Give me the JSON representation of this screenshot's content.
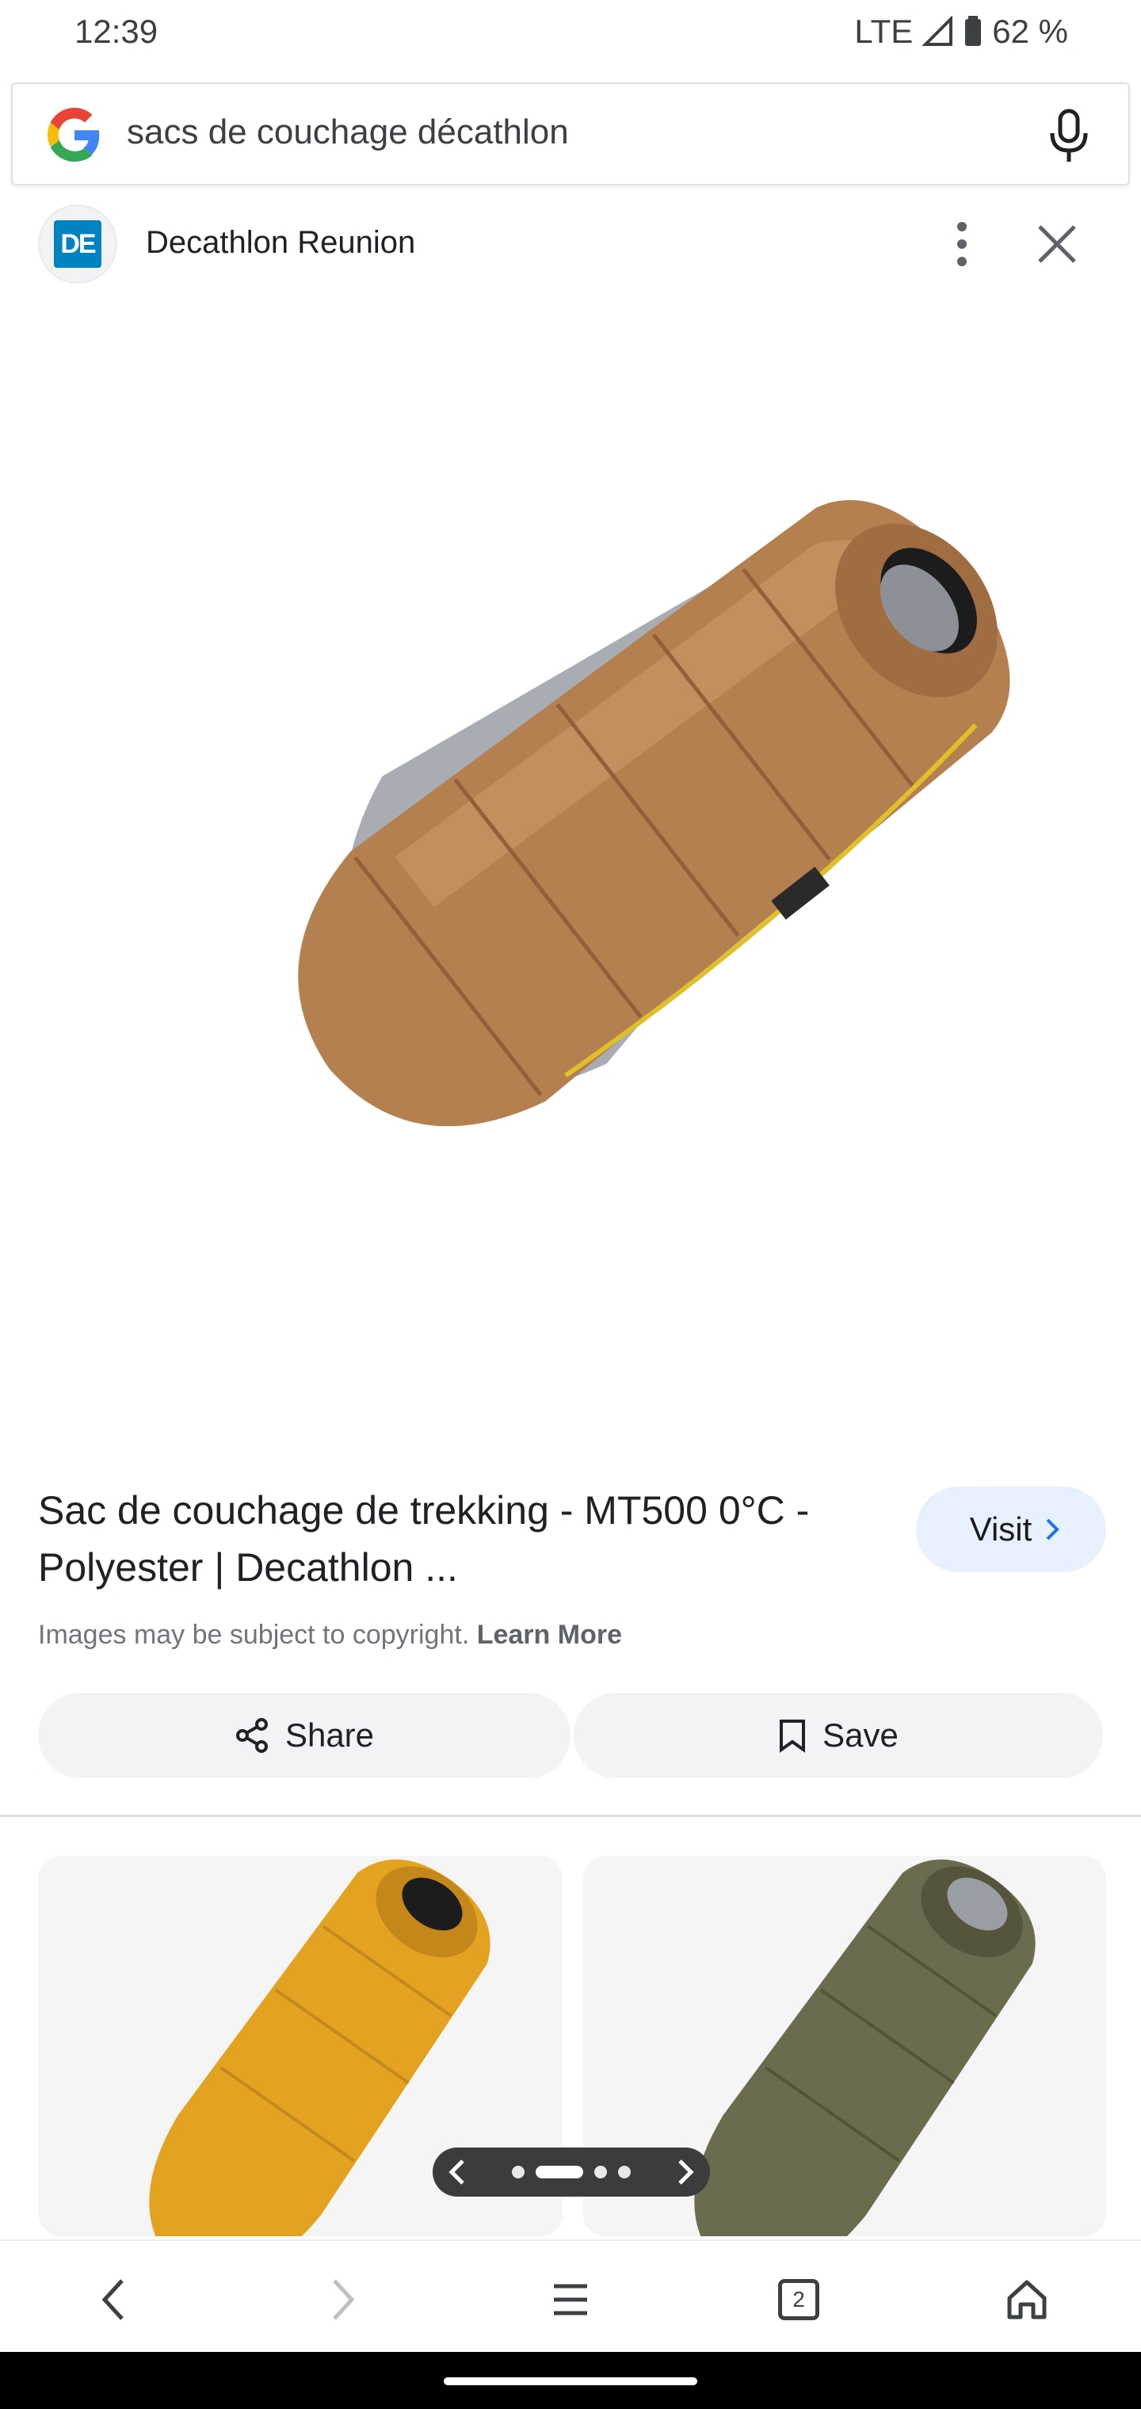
{
  "status_bar": {
    "time": "12:39",
    "network": "LTE",
    "battery": "62 %"
  },
  "search": {
    "query": "sacs de couchage décathlon",
    "logo_icon": "google-g-icon",
    "mic_icon": "microphone-icon"
  },
  "source": {
    "logo_text": "DE",
    "name": "Decathlon Reunion",
    "brand_color": "#0082c3"
  },
  "result": {
    "title": "Sac de couchage de trekking - MT500 0°C - Polyester | Decathlon ...",
    "visit_label": "Visit",
    "copyright_text": "Images may be subject to copyright.",
    "learn_more_label": "Learn More"
  },
  "actions": {
    "share_label": "Share",
    "save_label": "Save"
  },
  "related": [
    {
      "color": "#e3a321",
      "description": "orange sleeping bag"
    },
    {
      "color": "#6b6b4f",
      "description": "khaki sleeping bag"
    }
  ],
  "nav": {
    "tabs_count": "2"
  },
  "colors": {
    "accent_visit_bg": "#e8f0fe",
    "pill_bg": "#f1f3f4",
    "product_brown": "#b07c4f"
  }
}
